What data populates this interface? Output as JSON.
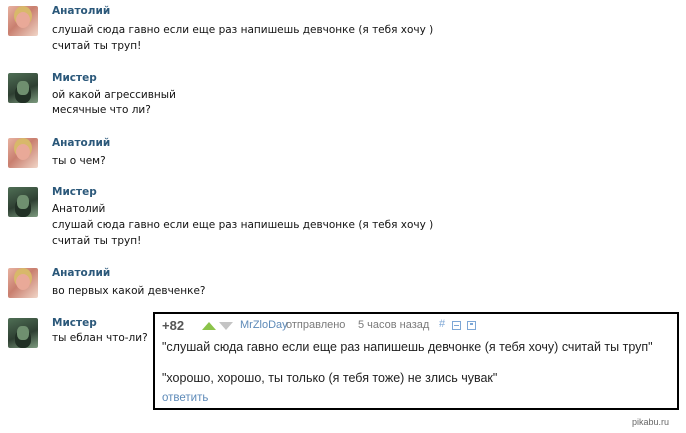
{
  "messages": [
    {
      "author": "Анатолий",
      "avatar": "anatoly-avatar",
      "lines": [
        "слушай сюда гавно если еще раз напишешь девчонке (я тебя хочу )",
        "считай ты труп!"
      ]
    },
    {
      "author": "Мистер",
      "avatar": "mister-avatar",
      "lines": [
        "ой какой агрессивный",
        "месячные что ли?"
      ]
    },
    {
      "author": "Анатолий",
      "avatar": "anatoly-avatar",
      "lines": [
        "ты о чем?"
      ]
    },
    {
      "author": "Мистер",
      "avatar": "mister-avatar",
      "lines": [
        "Анатолий",
        "слушай сюда гавно если еще раз напишешь девчонке (я тебя хочу )",
        "считай ты труп!"
      ]
    },
    {
      "author": "Анатолий",
      "avatar": "anatoly-avatar",
      "lines": [
        "во первых какой девченке?"
      ]
    },
    {
      "author": "Мистер",
      "avatar": "mister-avatar",
      "lines": [
        "ты еблан что-ли?"
      ]
    }
  ],
  "comment": {
    "rating": "+82",
    "username": "MrZloDay",
    "sent_label": "отправлено",
    "time": "5 часов назад",
    "hash": "#",
    "text1": "\"слушай сюда гавно если еще раз напишешь девчонке (я тебя хочу) считай ты труп\"",
    "text2": "\"хорошо, хорошо, ты только (я тебя тоже) не злись чувак\"",
    "reply": "ответить"
  },
  "watermark": "pikabu.ru",
  "colors": {
    "author": "#2b587a",
    "link": "#5d8ab8",
    "upvote": "#8bc34a"
  }
}
